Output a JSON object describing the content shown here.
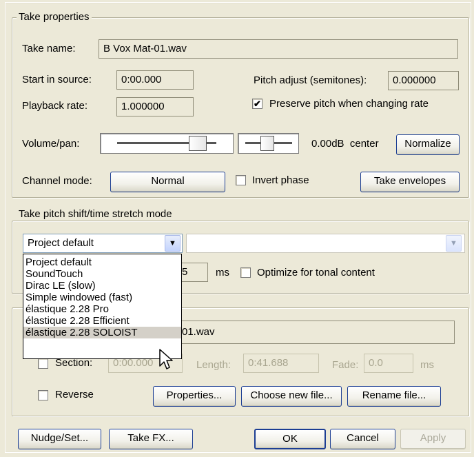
{
  "take_properties": {
    "group_label": "Take properties",
    "take_name_label": "Take name:",
    "take_name_value": "B Vox Mat-01.wav",
    "start_in_source_label": "Start in source:",
    "start_in_source_value": "0:00.000",
    "pitch_adjust_label": "Pitch adjust (semitones):",
    "pitch_adjust_value": "0.000000",
    "playback_rate_label": "Playback rate:",
    "playback_rate_value": "1.000000",
    "preserve_pitch_label": "Preserve pitch when changing rate",
    "preserve_pitch_checked": true,
    "volume_pan_label": "Volume/pan:",
    "volume_pan_readout": "0.00dB  center",
    "normalize_label": "Normalize",
    "channel_mode_label": "Channel mode:",
    "channel_mode_value": "Normal",
    "invert_phase_label": "Invert phase",
    "take_envelopes_label": "Take envelopes"
  },
  "pitch_shift": {
    "group_label": "Take pitch shift/time stretch mode",
    "selected_mode": "Project default",
    "options": [
      "Project default",
      "SoundTouch",
      "Dirac LE (slow)",
      "Simple windowed (fast)",
      "élastique 2.28 Pro",
      "élastique 2.28 Efficient",
      "élastique 2.28 SOLOIST"
    ],
    "highlighted_option": "élastique 2.28 SOLOIST",
    "partial_value": "5",
    "ms_label": "ms",
    "optimize_label": "Optimize for tonal content"
  },
  "source": {
    "file_partial": "01.wav",
    "section_label": "Section:",
    "section_value": "0:00.000",
    "length_label": "Length:",
    "length_value": "0:41.688",
    "fade_label": "Fade:",
    "fade_value": "0.0",
    "ms_label": "ms",
    "reverse_label": "Reverse",
    "properties_label": "Properties...",
    "choose_new_file_label": "Choose new file...",
    "rename_file_label": "Rename file..."
  },
  "footer": {
    "nudge_label": "Nudge/Set...",
    "take_fx_label": "Take FX...",
    "ok_label": "OK",
    "cancel_label": "Cancel",
    "apply_label": "Apply"
  },
  "icons": {
    "checkmark": "✔",
    "dropdown": "▼",
    "cursor": "arrow-cursor"
  }
}
